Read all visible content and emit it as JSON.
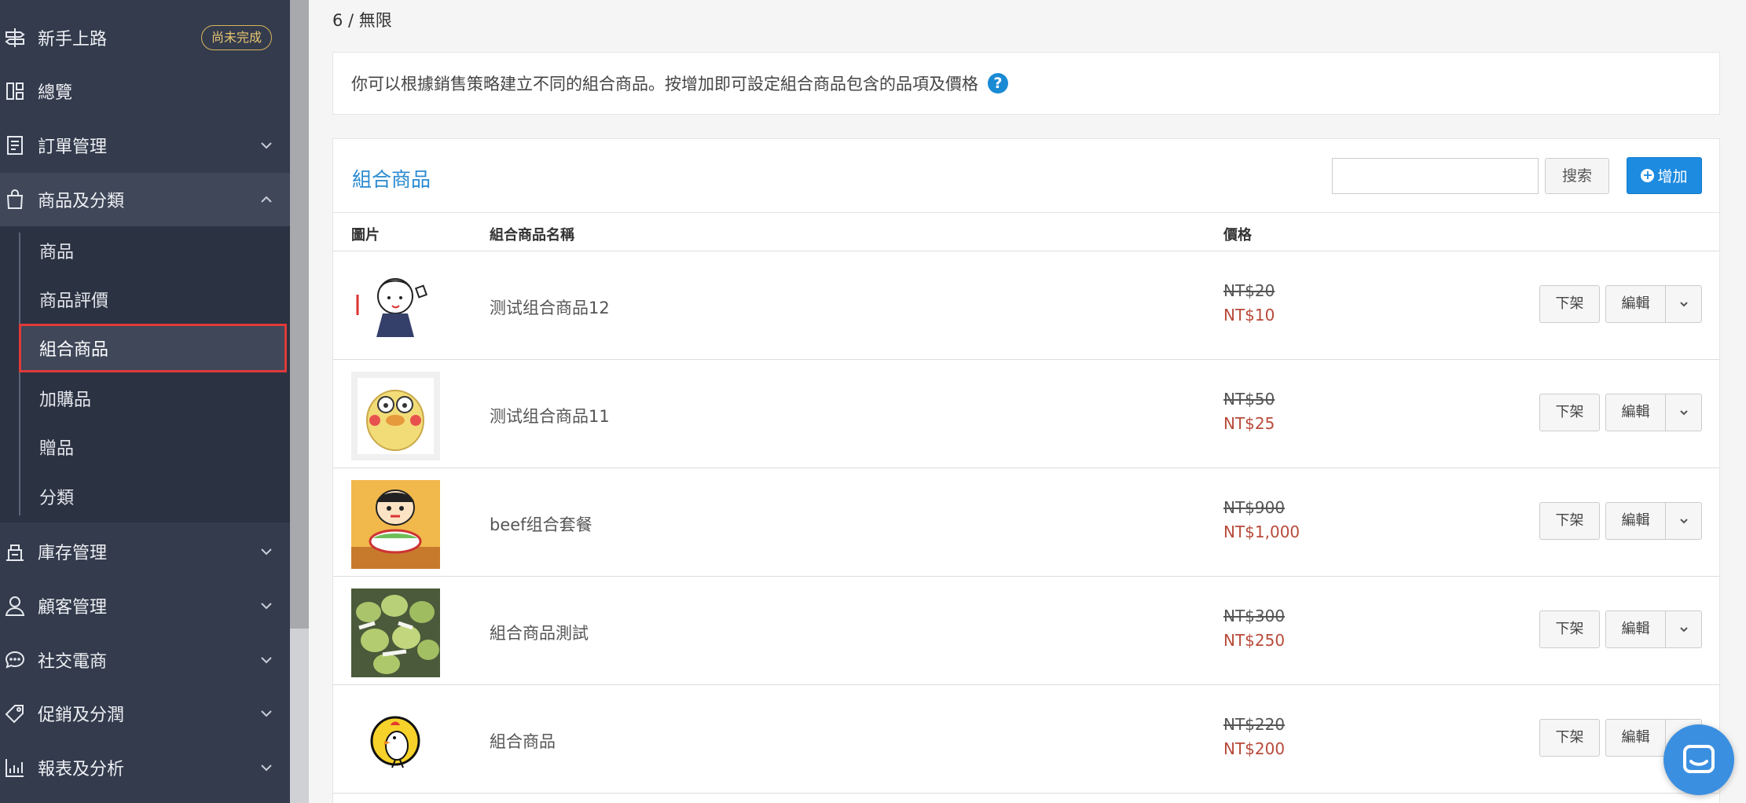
{
  "sidebar": {
    "onboarding": {
      "label": "新手上路",
      "badge": "尚未完成",
      "icon": "signpost-icon"
    },
    "overview": {
      "label": "總覽",
      "icon": "dashboard-icon"
    },
    "orders": {
      "label": "訂單管理",
      "icon": "receipt-icon"
    },
    "products": {
      "label": "商品及分類",
      "icon": "shopping-bag-icon"
    },
    "sub_items": [
      {
        "label": "商品"
      },
      {
        "label": "商品評價"
      },
      {
        "label": "組合商品"
      },
      {
        "label": "加購品"
      },
      {
        "label": "贈品"
      },
      {
        "label": "分類"
      }
    ],
    "inventory": {
      "label": "庫存管理",
      "icon": "warehouse-icon"
    },
    "customers": {
      "label": "顧客管理",
      "icon": "user-icon"
    },
    "social": {
      "label": "社交電商",
      "icon": "chat-bubble-icon"
    },
    "promotions": {
      "label": "促銷及分潤",
      "icon": "tag-icon"
    },
    "reports": {
      "label": "報表及分析",
      "icon": "bar-chart-icon"
    }
  },
  "main": {
    "limit_text": "6 / 無限",
    "info_text": "你可以根據銷售策略建立不同的組合商品。按增加即可設定組合商品包含的品項及價格",
    "panel_title": "組合商品",
    "search_button": "搜索",
    "add_button": "增加",
    "columns": {
      "image": "圖片",
      "name": "組合商品名稱",
      "price": "價格"
    },
    "row_buttons": {
      "unlist": "下架",
      "edit": "編輯"
    },
    "rows": [
      {
        "name": "测试组合商品12",
        "original_price": "NT$20",
        "sale_price": "NT$10"
      },
      {
        "name": "测试组合商品11",
        "original_price": "NT$50",
        "sale_price": "NT$25"
      },
      {
        "name": "beef组合套餐",
        "original_price": "NT$900",
        "sale_price": "NT$1,000"
      },
      {
        "name": "組合商品測試",
        "original_price": "NT$300",
        "sale_price": "NT$250"
      },
      {
        "name": "組合商品",
        "original_price": "NT$220",
        "sale_price": "NT$200"
      }
    ]
  },
  "colors": {
    "sidebar_bg": "#333b4d",
    "accent_blue": "#1d8be0",
    "sale_red": "#b84a3a",
    "badge_gold": "#d9b55a",
    "highlight_red": "#e03a3a"
  }
}
